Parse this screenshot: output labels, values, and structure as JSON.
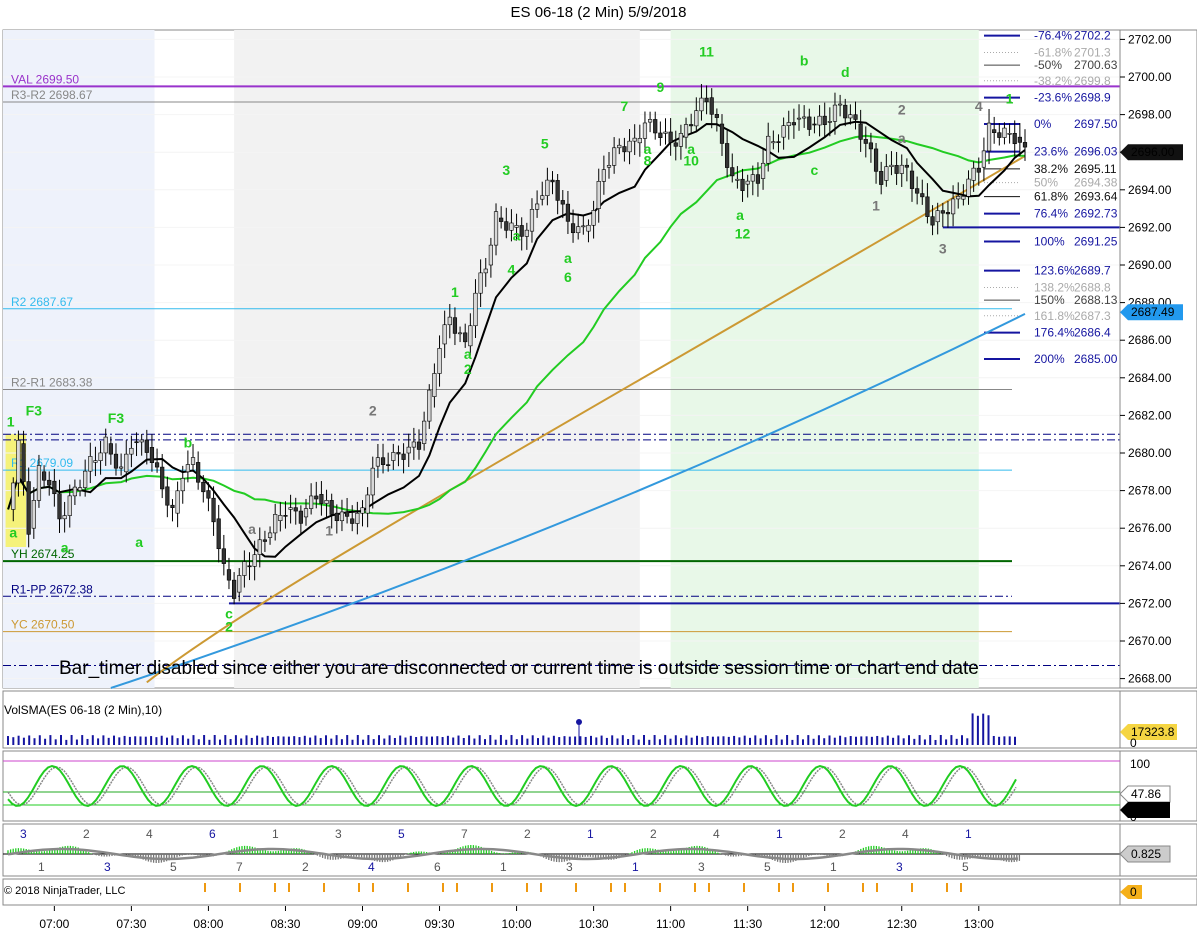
{
  "title": "ES 06-18 (2 Min)  5/9/2018",
  "copyright": "© 2018 NinjaTrader, LLC",
  "notice": "Bar_timer disabled since either you are disconnected or current time is outside session time or chart end date",
  "chart_data": {
    "type": "candlestick",
    "instrument": "ES 06-18 (2 Min)",
    "date": "5/9/2018",
    "x_ticks": [
      "07:00",
      "07:30",
      "08:00",
      "08:30",
      "09:00",
      "09:30",
      "10:00",
      "10:30",
      "11:00",
      "11:30",
      "12:00",
      "12:30",
      "13:00"
    ],
    "y_ticks": [
      2668,
      2670,
      2672,
      2674,
      2676,
      2678,
      2680,
      2682,
      2684,
      2686,
      2688,
      2690,
      2692,
      2694,
      2696,
      2698,
      2700,
      2702
    ],
    "y_tick_labels": [
      "2668.00",
      "2670.00",
      "2672.00",
      "2674.00",
      "2676.00",
      "2678.00",
      "2680.00",
      "2682.00",
      "2684.00",
      "2686.00",
      "2688.00",
      "2690.00",
      "2692.00",
      "2694.00",
      "2696.00",
      "2698.00",
      "2700.00",
      "2702.00"
    ],
    "ylim": [
      2667.5,
      2702.5
    ],
    "time_range": [
      "06:40",
      "13:55"
    ],
    "last_price_label": "2696.00",
    "last_price": 2696.0,
    "cyan_price_label": "2687.49",
    "cyan_price": 2687.49,
    "close_path": [
      [
        "06:42",
        2677
      ],
      [
        "06:46",
        2680.5
      ],
      [
        "06:50",
        2676
      ],
      [
        "06:54",
        2679
      ],
      [
        "06:58",
        2678.5
      ],
      [
        "07:02",
        2676.5
      ],
      [
        "07:08",
        2678
      ],
      [
        "07:14",
        2679.5
      ],
      [
        "07:20",
        2680.5
      ],
      [
        "07:26",
        2679
      ],
      [
        "07:30",
        2680.6
      ],
      [
        "07:36",
        2680.3
      ],
      [
        "07:42",
        2678.2
      ],
      [
        "07:46",
        2676.8
      ],
      [
        "07:50",
        2679
      ],
      [
        "07:54",
        2679.5
      ],
      [
        "07:58",
        2678
      ],
      [
        "08:02",
        2676.5
      ],
      [
        "08:06",
        2673.8
      ],
      [
        "08:10",
        2672.6
      ],
      [
        "08:14",
        2674
      ],
      [
        "08:18",
        2674.6
      ],
      [
        "08:22",
        2675.5
      ],
      [
        "08:26",
        2676.4
      ],
      [
        "08:30",
        2677
      ],
      [
        "08:36",
        2676.6
      ],
      [
        "08:42",
        2677.8
      ],
      [
        "08:48",
        2676.8
      ],
      [
        "08:54",
        2676.5
      ],
      [
        "09:00",
        2676.8
      ],
      [
        "09:04",
        2679.3
      ],
      [
        "09:10",
        2679.6
      ],
      [
        "09:16",
        2680
      ],
      [
        "09:22",
        2680.5
      ],
      [
        "09:26",
        2683
      ],
      [
        "09:30",
        2685.8
      ],
      [
        "09:34",
        2687.2
      ],
      [
        "09:40",
        2685.7
      ],
      [
        "09:44",
        2688.5
      ],
      [
        "09:48",
        2690
      ],
      [
        "09:52",
        2692.5
      ],
      [
        "09:58",
        2692
      ],
      [
        "10:04",
        2691.8
      ],
      [
        "10:08",
        2693.5
      ],
      [
        "10:14",
        2694.5
      ],
      [
        "10:20",
        2692.2
      ],
      [
        "10:26",
        2691.8
      ],
      [
        "10:30",
        2693
      ],
      [
        "10:34",
        2695.2
      ],
      [
        "10:40",
        2696.3
      ],
      [
        "10:46",
        2696.5
      ],
      [
        "10:50",
        2697.6
      ],
      [
        "10:56",
        2697
      ],
      [
        "11:00",
        2696.5
      ],
      [
        "11:04",
        2696.8
      ],
      [
        "11:10",
        2698.2
      ],
      [
        "11:14",
        2698.9
      ],
      [
        "11:18",
        2697.5
      ],
      [
        "11:24",
        2694.5
      ],
      [
        "11:28",
        2694.3
      ],
      [
        "11:34",
        2694.6
      ],
      [
        "11:38",
        2696.5
      ],
      [
        "11:42",
        2696.8
      ],
      [
        "11:48",
        2697.8
      ],
      [
        "11:54",
        2697.5
      ],
      [
        "12:00",
        2697.6
      ],
      [
        "12:06",
        2698.5
      ],
      [
        "12:12",
        2697.5
      ],
      [
        "12:16",
        2696.5
      ],
      [
        "12:22",
        2694.5
      ],
      [
        "12:26",
        2695.3
      ],
      [
        "12:32",
        2695
      ],
      [
        "12:36",
        2693.8
      ],
      [
        "12:42",
        2692.3
      ],
      [
        "12:46",
        2692.8
      ],
      [
        "12:52",
        2693.5
      ],
      [
        "12:56",
        2694.5
      ],
      [
        "13:00",
        2695.2
      ],
      [
        "13:04",
        2697.2
      ],
      [
        "13:10",
        2697
      ],
      [
        "13:14",
        2696.8
      ],
      [
        "13:18",
        2696
      ]
    ],
    "levels": [
      {
        "label": "VAL 2699.50",
        "value": 2699.5,
        "color": "#9933cc"
      },
      {
        "label": "R3-R2 2698.67",
        "value": 2698.67,
        "color": "#888888"
      },
      {
        "label": "R2 2687.67",
        "value": 2687.67,
        "color": "#33bbee"
      },
      {
        "label": "R2-R1 2683.38",
        "value": 2683.38,
        "color": "#888888"
      },
      {
        "label": "R1 2679.09",
        "value": 2679.09,
        "color": "#33bbee"
      },
      {
        "label": "YH 2674.25",
        "value": 2674.25,
        "color": "#006600"
      },
      {
        "label": "R1-PP 2672.38",
        "value": 2672.38,
        "color": "#000080"
      },
      {
        "label": "YC 2670.50",
        "value": 2670.5,
        "color": "#cc9933"
      }
    ],
    "fib_levels": [
      {
        "label": "-76.4%",
        "price": "2702.2",
        "value": 2702.2,
        "color": "#1515a0"
      },
      {
        "label": "-61.8%",
        "price": "2701.3",
        "value": 2701.3,
        "color": "#aaaaaa"
      },
      {
        "label": "-50%",
        "price": "2700.63",
        "value": 2700.63,
        "color": "#444444"
      },
      {
        "label": "-38.2%",
        "price": "2699.8",
        "value": 2699.8,
        "color": "#aaaaaa"
      },
      {
        "label": "-23.6%",
        "price": "2698.9",
        "value": 2698.9,
        "color": "#1515a0"
      },
      {
        "label": "0%",
        "price": "2697.50",
        "value": 2697.5,
        "color": "#1515a0"
      },
      {
        "label": "23.6%",
        "price": "2696.03",
        "value": 2696.03,
        "color": "#1515a0"
      },
      {
        "label": "38.2%",
        "price": "2695.11",
        "value": 2695.11,
        "color": "#111111"
      },
      {
        "label": "50%",
        "price": "2694.38",
        "value": 2694.38,
        "color": "#aaaaaa"
      },
      {
        "label": "61.8%",
        "price": "2693.64",
        "value": 2693.64,
        "color": "#111111"
      },
      {
        "label": "76.4%",
        "price": "2692.73",
        "value": 2692.73,
        "color": "#1515a0"
      },
      {
        "label": "100%",
        "price": "2691.25",
        "value": 2691.25,
        "color": "#1515a0"
      },
      {
        "label": "123.6%",
        "price": "2689.7",
        "value": 2689.7,
        "color": "#1515a0"
      },
      {
        "label": "138.2%",
        "price": "2688.8",
        "value": 2688.8,
        "color": "#aaaaaa"
      },
      {
        "label": "150%",
        "price": "2688.13",
        "value": 2688.13,
        "color": "#444444"
      },
      {
        "label": "161.8%",
        "price": "2687.3",
        "value": 2687.3,
        "color": "#aaaaaa"
      },
      {
        "label": "176.4%",
        "price": "2686.4",
        "value": 2686.4,
        "color": "#1515a0"
      },
      {
        "label": "200%",
        "price": "2685.00",
        "value": 2685.0,
        "color": "#1515a0"
      }
    ],
    "wave_labels": [
      {
        "text": "1",
        "t": "06:43",
        "v": 2681.4,
        "color": "#22cc22"
      },
      {
        "text": "F3",
        "t": "06:52",
        "v": 2682,
        "color": "#22cc22"
      },
      {
        "text": "F3",
        "t": "07:24",
        "v": 2681.6,
        "color": "#22cc22"
      },
      {
        "text": "b",
        "t": "07:52",
        "v": 2680.3,
        "color": "#22cc22"
      },
      {
        "text": "a",
        "t": "06:44",
        "v": 2675.5,
        "color": "#22cc22"
      },
      {
        "text": "a",
        "t": "07:04",
        "v": 2674.7,
        "color": "#22cc22"
      },
      {
        "text": "a",
        "t": "07:33",
        "v": 2675,
        "color": "#22cc22"
      },
      {
        "text": "c",
        "t": "08:08",
        "v": 2671.2,
        "color": "#22cc22"
      },
      {
        "text": "2",
        "t": "08:08",
        "v": 2670.5,
        "color": "#22cc22"
      },
      {
        "text": "a",
        "t": "08:17",
        "v": 2675.7,
        "color": "#777777"
      },
      {
        "text": "1",
        "t": "08:47",
        "v": 2675.6,
        "color": "#777777"
      },
      {
        "text": "2",
        "t": "09:04",
        "v": 2682,
        "color": "#777777"
      },
      {
        "text": "1",
        "t": "09:36",
        "v": 2688.3,
        "color": "#22cc22"
      },
      {
        "text": "a",
        "t": "09:41",
        "v": 2685,
        "color": "#22cc22"
      },
      {
        "text": "2",
        "t": "09:41",
        "v": 2684.2,
        "color": "#22cc22"
      },
      {
        "text": "3",
        "t": "09:56",
        "v": 2694.8,
        "color": "#22cc22"
      },
      {
        "text": "a",
        "t": "10:00",
        "v": 2691.3,
        "color": "#22cc22"
      },
      {
        "text": "4",
        "t": "09:58",
        "v": 2689.5,
        "color": "#22cc22"
      },
      {
        "text": "5",
        "t": "10:11",
        "v": 2696.2,
        "color": "#22cc22"
      },
      {
        "text": "a",
        "t": "10:20",
        "v": 2690.1,
        "color": "#22cc22"
      },
      {
        "text": "6",
        "t": "10:20",
        "v": 2689.1,
        "color": "#22cc22"
      },
      {
        "text": "7",
        "t": "10:42",
        "v": 2698.2,
        "color": "#22cc22"
      },
      {
        "text": "a",
        "t": "10:51",
        "v": 2695.9,
        "color": "#22cc22"
      },
      {
        "text": "8",
        "t": "10:51",
        "v": 2695.3,
        "color": "#22cc22"
      },
      {
        "text": "9",
        "t": "10:56",
        "v": 2699.2,
        "color": "#22cc22"
      },
      {
        "text": "a",
        "t": "11:08",
        "v": 2695.9,
        "color": "#22cc22"
      },
      {
        "text": "10",
        "t": "11:08",
        "v": 2695.3,
        "color": "#22cc22"
      },
      {
        "text": "11",
        "t": "11:14",
        "v": 2701.1,
        "color": "#22cc22"
      },
      {
        "text": "a",
        "t": "11:27",
        "v": 2692.4,
        "color": "#22cc22"
      },
      {
        "text": "12",
        "t": "11:28",
        "v": 2691.4,
        "color": "#22cc22"
      },
      {
        "text": "b",
        "t": "11:52",
        "v": 2700.6,
        "color": "#22cc22"
      },
      {
        "text": "c",
        "t": "11:56",
        "v": 2694.8,
        "color": "#22cc22"
      },
      {
        "text": "d",
        "t": "12:08",
        "v": 2700,
        "color": "#22cc22"
      },
      {
        "text": "2",
        "t": "12:30",
        "v": 2698,
        "color": "#777777"
      },
      {
        "text": "a",
        "t": "12:30",
        "v": 2696.5,
        "color": "#777777"
      },
      {
        "text": "1",
        "t": "12:20",
        "v": 2692.9,
        "color": "#777777"
      },
      {
        "text": "3",
        "t": "12:46",
        "v": 2690.6,
        "color": "#777777"
      },
      {
        "text": "4",
        "t": "13:00",
        "v": 2698.2,
        "color": "#777777"
      },
      {
        "text": "1",
        "t": "13:12",
        "v": 2698.6,
        "color": "#22cc22"
      }
    ],
    "volume_indicator": {
      "label": "VolSMA(ES 06-18 (2 Min),10)",
      "value_label": "17323.8",
      "zero_label": "0"
    },
    "stochastic": {
      "top_label": "100",
      "value1": "47.86",
      "value2": "16.67",
      "zero_label": "0"
    },
    "oscillator": {
      "value_label": "0.825"
    },
    "bottom_value": "0",
    "osc_labels_above": [
      "3",
      "2",
      "4",
      "6",
      "1",
      "3",
      "5",
      "7",
      "2",
      "1",
      "2",
      "4",
      "1",
      "2",
      "4",
      "1"
    ],
    "osc_labels_below": [
      "1",
      "3",
      "5",
      "7",
      "2",
      "4",
      "6",
      "1",
      "3",
      "1",
      "3",
      "5",
      "1",
      "3",
      "5"
    ]
  },
  "colors": {
    "up_candle": "#d8d8d8",
    "down_candle": "#333333",
    "ma_black": "#000000",
    "ma_green": "#22cc22",
    "ma_gold": "#cc9933",
    "ma_blue": "#3399dd",
    "ma_gray": "#999999",
    "blue_line": "#1515a0"
  }
}
